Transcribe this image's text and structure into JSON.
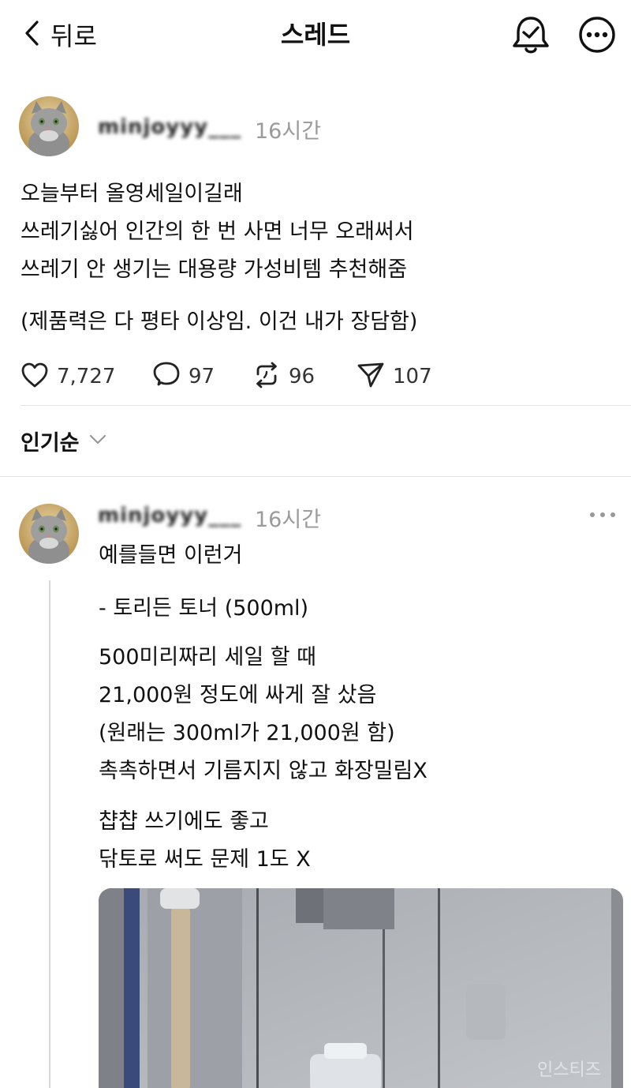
{
  "header": {
    "back_label": "뒤로",
    "title": "스레드"
  },
  "post": {
    "username": "minjoyyy___",
    "time": "16시간",
    "lines": [
      "오늘부터 올영세일이길래",
      "쓰레기싫어 인간의 한 번 사면 너무 오래써서",
      "쓰레기 안 생기는 대용량 가성비템 추천해줌"
    ],
    "note": "(제품력은 다 평타 이상임. 이건 내가 장담함)",
    "stats": {
      "likes": "7,727",
      "comments": "97",
      "reposts": "96",
      "shares": "107"
    }
  },
  "sort": {
    "label": "인기순"
  },
  "reply": {
    "username": "minjoyyy___",
    "time": "16시간",
    "intro": "예를들면 이런거",
    "product": "- 토리든 토너 (500ml)",
    "paragraph1": [
      "500미리짜리 세일 할 때",
      "21,000원 정도에 싸게 잘 샀음",
      "(원래는 300ml가 21,000원 함)",
      "촉촉하면서 기름지지 않고 화장밀림X"
    ],
    "paragraph2": [
      "챱챱 쓰기에도 좋고",
      "닦토로 써도 문제 1도 X"
    ],
    "image_watermark": "인스티즈"
  },
  "colors": {
    "text": "#111111",
    "muted": "#9a9a9a",
    "divider": "#e3e3e3",
    "thread_line": "#d7d7d7"
  },
  "icons": [
    "back-chevron-icon",
    "bell-check-icon",
    "more-options-icon",
    "heart-icon",
    "comment-icon",
    "repost-icon",
    "send-icon",
    "chevron-down-icon",
    "ellipsis-icon"
  ]
}
